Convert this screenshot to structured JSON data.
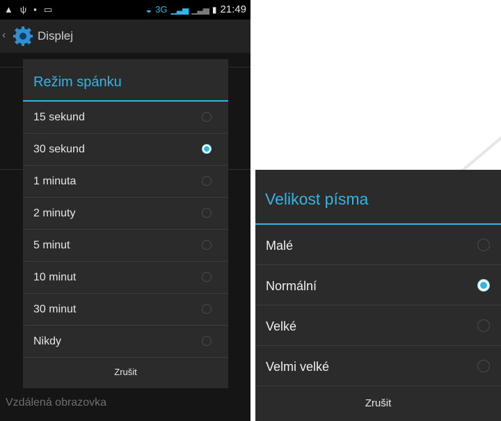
{
  "status_bar": {
    "time": "21:49",
    "network": "3G",
    "left_icons": [
      "warning-icon",
      "usb-icon",
      "lock-icon",
      "screenshot-icon"
    ],
    "right_icons": [
      "wifi-icon",
      "signal-icon",
      "signal-sim2-icon",
      "battery-icon"
    ]
  },
  "action_bar": {
    "title": "Displej",
    "icon": "gear-icon"
  },
  "background": {
    "visible_item": "Vzdálená obrazovka"
  },
  "sleep_dialog": {
    "title": "Režim spánku",
    "options": [
      {
        "label": "15 sekund",
        "selected": false
      },
      {
        "label": "30 sekund",
        "selected": true
      },
      {
        "label": "1 minuta",
        "selected": false
      },
      {
        "label": "2 minuty",
        "selected": false
      },
      {
        "label": "5 minut",
        "selected": false
      },
      {
        "label": "10 minut",
        "selected": false
      },
      {
        "label": "30 minut",
        "selected": false
      },
      {
        "label": "Nikdy",
        "selected": false
      }
    ],
    "cancel_label": "Zrušit"
  },
  "font_dialog": {
    "title": "Velikost písma",
    "options": [
      {
        "label": "Malé",
        "selected": false
      },
      {
        "label": "Normální",
        "selected": true
      },
      {
        "label": "Velké",
        "selected": false
      },
      {
        "label": "Velmi velké",
        "selected": false
      }
    ],
    "cancel_label": "Zrušit"
  },
  "colors": {
    "accent": "#33b5e5",
    "dialog_bg": "#2b2b2b",
    "action_bar_bg": "#232323"
  }
}
